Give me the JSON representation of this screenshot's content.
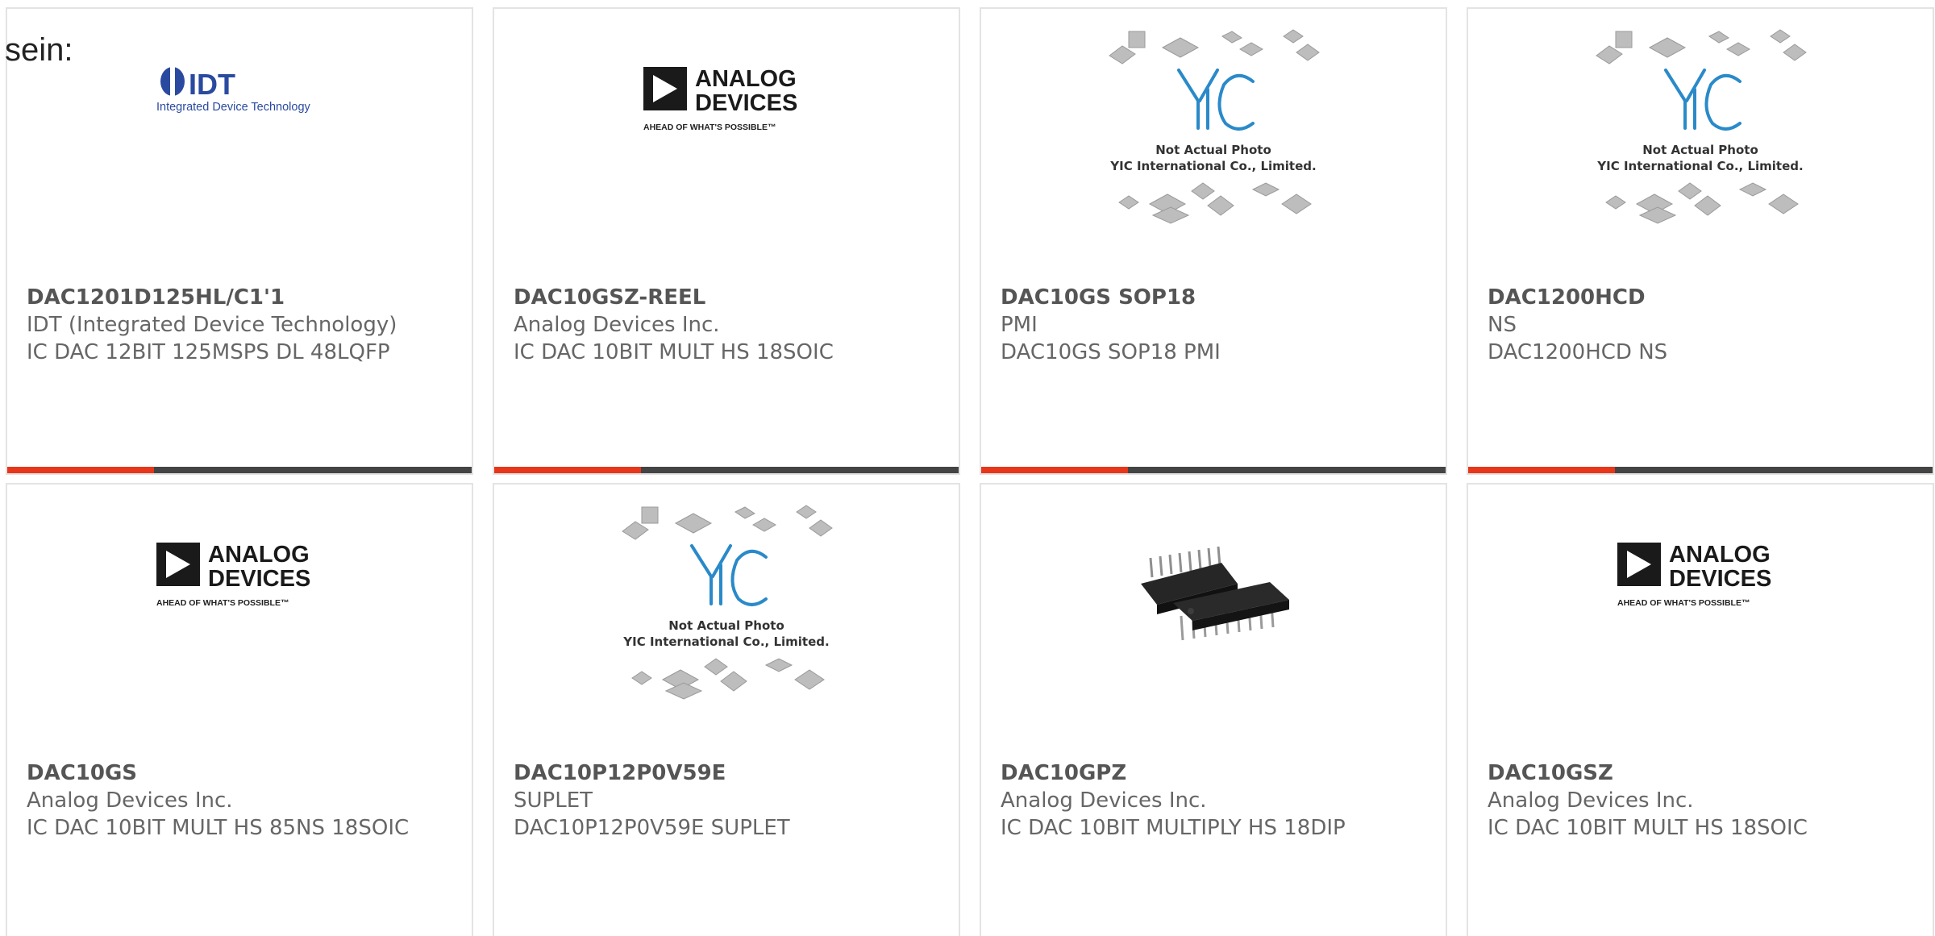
{
  "intro_text": "sein:",
  "colors": {
    "accent": "#e8361a",
    "bar": "#444444",
    "idt_blue": "#2a4aa0",
    "yic_blue": "#2a8ac9"
  },
  "image_texts": {
    "idt_logo": "IDT",
    "idt_tagline": "Integrated Device Technology",
    "adi_line1": "ANALOG",
    "adi_line2": "DEVICES",
    "adi_tagline": "AHEAD OF WHAT'S POSSIBLE™",
    "yic_line1": "Not Actual Photo",
    "yic_line2": "YIC International Co., Limited."
  },
  "products": [
    {
      "part": "DAC1201D125HL/C1'1",
      "manufacturer": "IDT (Integrated Device Technology)",
      "description": "IC DAC 12BIT 125MSPS DL 48LQFP",
      "image": "idt-logo"
    },
    {
      "part": "DAC10GSZ-REEL",
      "manufacturer": "Analog Devices Inc.",
      "description": "IC DAC 10BIT MULT HS 18SOIC",
      "image": "analog-devices-logo"
    },
    {
      "part": "DAC10GS SOP18",
      "manufacturer": "PMI",
      "description": "DAC10GS SOP18 PMI",
      "image": "yic-placeholder"
    },
    {
      "part": "DAC1200HCD",
      "manufacturer": "NS",
      "description": "DAC1200HCD NS",
      "image": "yic-placeholder"
    },
    {
      "part": "DAC10GS",
      "manufacturer": "Analog Devices Inc.",
      "description": "IC DAC 10BIT MULT HS 85NS 18SOIC",
      "image": "analog-devices-logo"
    },
    {
      "part": "DAC10P12P0V59E",
      "manufacturer": "SUPLET",
      "description": "DAC10P12P0V59E SUPLET",
      "image": "yic-placeholder"
    },
    {
      "part": "DAC10GPZ",
      "manufacturer": "Analog Devices Inc.",
      "description": "IC DAC 10BIT MULTIPLY HS 18DIP",
      "image": "dip-chip-photo"
    },
    {
      "part": "DAC10GSZ",
      "manufacturer": "Analog Devices Inc.",
      "description": "IC DAC 10BIT MULT HS 18SOIC",
      "image": "analog-devices-logo"
    }
  ]
}
